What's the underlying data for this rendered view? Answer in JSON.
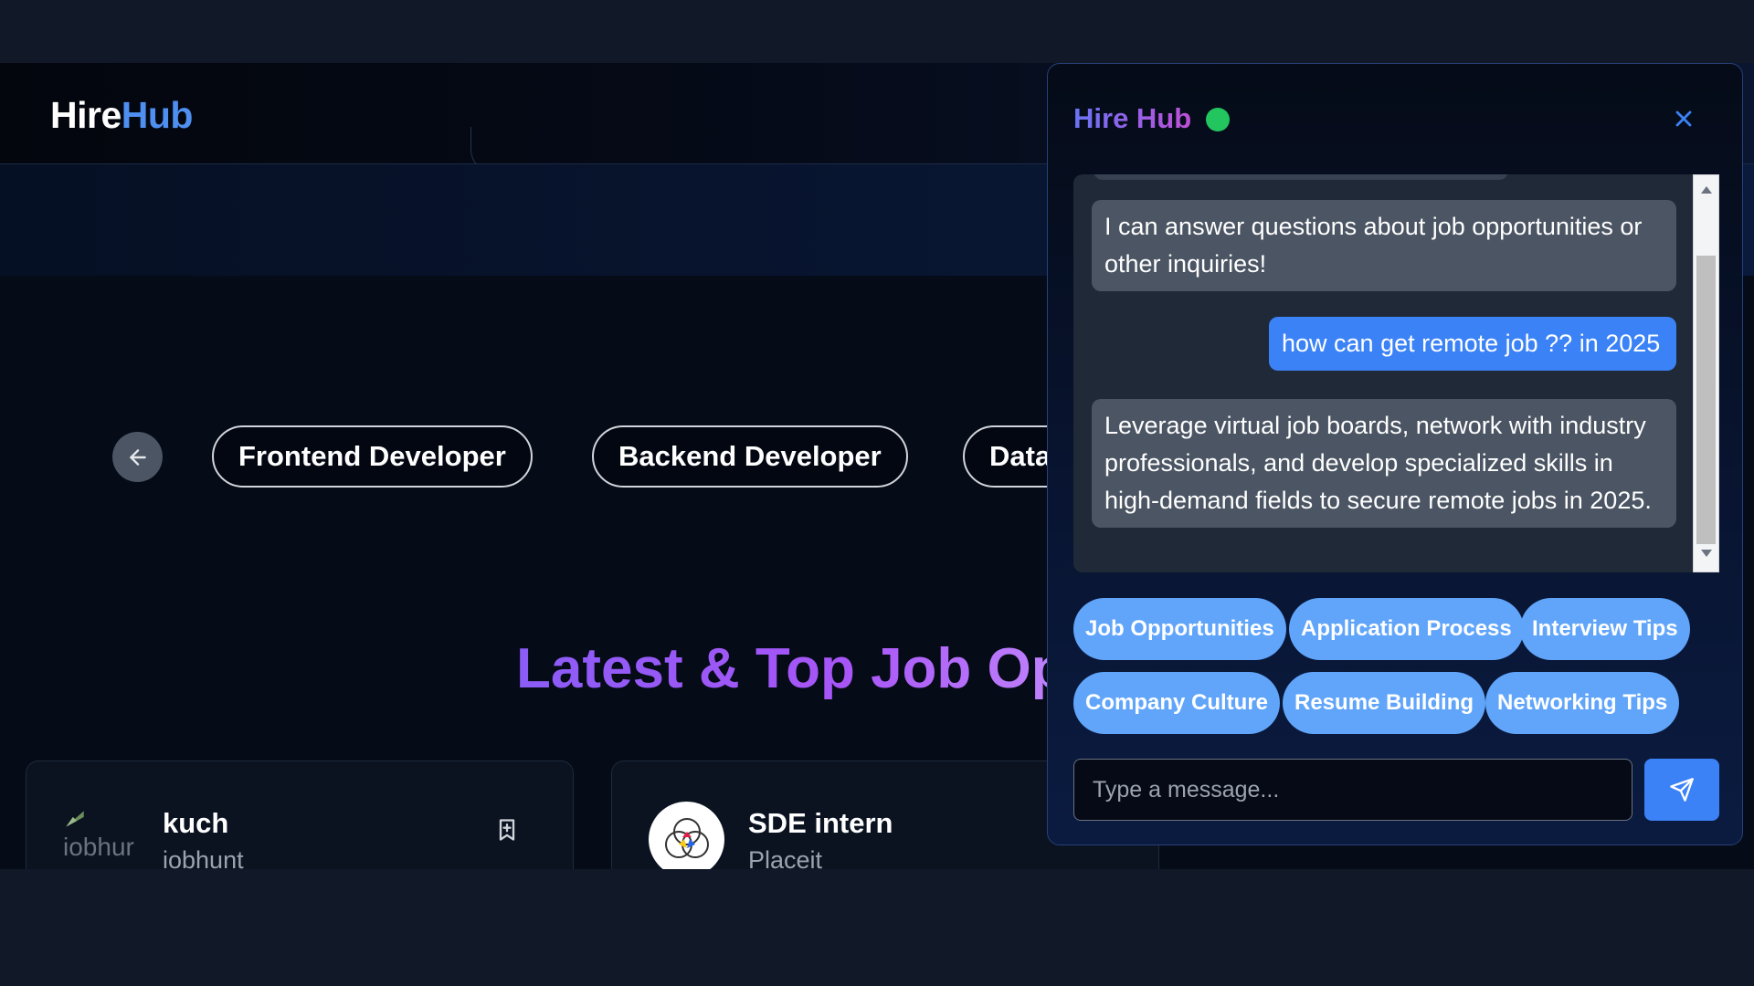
{
  "header": {
    "logo_part1": "Hire",
    "logo_part2": "Hub"
  },
  "categories": {
    "items": [
      "Frontend Developer",
      "Backend Developer",
      "Data"
    ]
  },
  "section": {
    "title": "Latest & Top Job Op"
  },
  "jobs": [
    {
      "title": "kuch",
      "company": "iobhunt",
      "logo_alt": "iobhur"
    },
    {
      "title": "SDE intern",
      "company": "Placeit"
    }
  ],
  "chat": {
    "title": "Hire Hub",
    "messages": [
      {
        "role": "bot",
        "text": "I can answer questions about job opportunities or other inquiries!"
      },
      {
        "role": "user",
        "text": "how can get remote job ?? in 2025"
      },
      {
        "role": "bot",
        "text": "Leverage virtual job boards, network with industry professionals, and develop specialized skills in high-demand fields to secure remote jobs in 2025."
      }
    ],
    "suggestions": [
      "Job Opportunities",
      "Application Process",
      "Interview Tips",
      "Company Culture",
      "Resume Building",
      "Networking Tips"
    ],
    "input_placeholder": "Type a message...",
    "online_color": "#22c55e"
  }
}
